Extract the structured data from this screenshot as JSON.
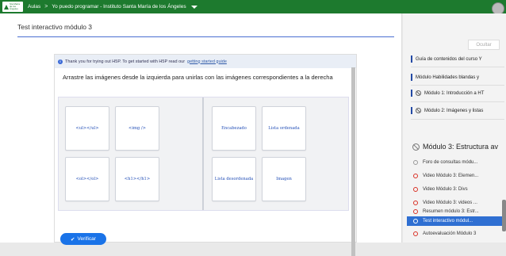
{
  "topbar": {
    "logo_text": "Sta María de los Ángeles",
    "crumb_1": "Aulas",
    "crumb_2": "Yo puedo programar - Instituto Santa María de los Ángeles",
    "sep": ">"
  },
  "page": {
    "title": "Test interactivo módulo 3"
  },
  "h5p": {
    "notice_prefix": "Thank you for trying out H5P. To get started with H5P read our",
    "notice_link": "getting started guide",
    "question": "Arrastre las imágenes desde la izquierda para unirlas con las imágenes correspondientes a la derecha",
    "left_cards": [
      "<ul></ul>",
      "<img />",
      "<ol></ol>",
      "<h1></h1>"
    ],
    "right_cards": [
      "Encabezado",
      "Lista ordenada",
      "Lista desordenada",
      "Imagen"
    ],
    "verify_label": "Verificar"
  },
  "sidebar": {
    "hide_button": "Ocultar",
    "items": [
      "Guía de contenidos del curso Y",
      "Módulo Habilidades blandas y",
      "Módulo 1: Introducción a HT",
      "Módulo 2: Imágenes y listas"
    ],
    "section_title": "Módulo 3: Estructura av",
    "activities": [
      "Foro de consultas módu...",
      "Video Módulo 3: Elemen...",
      "Video Módulo 3: Divs",
      "Video Módulo 3: videos ...",
      "Resumen módulo 3: Estr...",
      "Test interactivo módul...",
      "Autoevaluación Módulo 3"
    ]
  },
  "colors": {
    "topbar": "#1d7a2e",
    "accent": "#2f6fd2",
    "verify": "#1a73e8"
  }
}
